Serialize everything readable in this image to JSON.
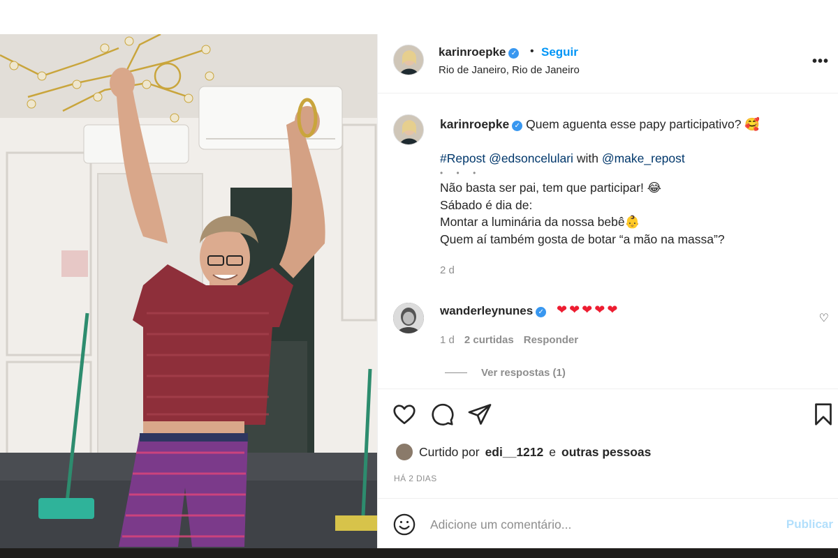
{
  "photo": {
    "tag_username": "edsoncelulari"
  },
  "header": {
    "username": "karinroepke",
    "separator": "•",
    "follow_label": "Seguir",
    "location": "Rio de Janeiro, Rio de Janeiro",
    "more_label": "•••"
  },
  "caption": {
    "username": "karinroepke",
    "text": "Quem aguenta esse papy participativo? 🥰",
    "repost_hashtag": "#Repost",
    "repost_user": "@edsoncelulari",
    "repost_with": "with",
    "repost_app": "@make_repost",
    "dots": "• • •",
    "lines": [
      "Não basta ser pai, tem que participar! 😂",
      "Sábado é dia de:",
      "Montar a luminária da nossa bebê👶",
      "Quem aí também gosta de botar “a mão na massa”?"
    ],
    "time": "2 d"
  },
  "comment": {
    "username": "wanderleynunes",
    "text": "❤❤❤❤❤",
    "time": "1 d",
    "likes": "2 curtidas",
    "reply_label": "Responder",
    "view_replies": "Ver respostas (1)",
    "like_icon": "♡"
  },
  "actions": {
    "liked_by_prefix": "Curtido por",
    "liked_by_user": "edi__1212",
    "liked_by_and": "e",
    "liked_by_rest": "outras pessoas",
    "date": "HÁ 2 DIAS"
  },
  "comment_box": {
    "placeholder": "Adicione um comentário...",
    "publish_label": "Publicar"
  },
  "colors": {
    "accent": "#0095f6",
    "verified": "#3897f0",
    "heart": "#ed1d31",
    "muted": "#8e8e8e"
  }
}
